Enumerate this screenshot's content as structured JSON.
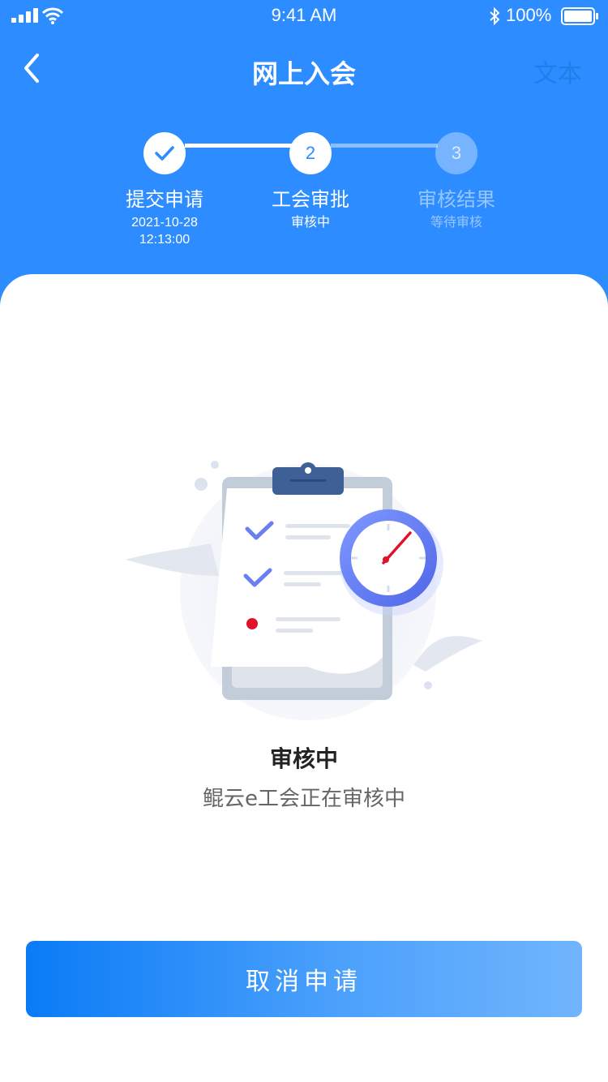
{
  "status_bar": {
    "time": "9:41 AM",
    "battery_percent": "100%",
    "icons": [
      "signal-icon",
      "wifi-icon",
      "bluetooth-icon",
      "battery-icon"
    ]
  },
  "nav": {
    "back_icon": "chevron-left-icon",
    "title": "网上入会",
    "right_text": "文本"
  },
  "steps": [
    {
      "number": "",
      "label": "提交申请",
      "sub": "2021-10-28",
      "sub2": "12:13:00",
      "state": "done",
      "icon": "check-icon"
    },
    {
      "number": "2",
      "label": "工会审批",
      "sub": "审核中",
      "state": "current"
    },
    {
      "number": "3",
      "label": "审核结果",
      "sub": "等待审核",
      "state": "pending"
    }
  ],
  "status": {
    "illustration": "clipboard-clock-illustration",
    "title": "审核中",
    "description": "鲲云e工会正在审核中"
  },
  "actions": {
    "cancel_label": "取消申请"
  },
  "colors": {
    "primary": "#2d8cff",
    "accent_red": "#e0112b",
    "text_dark": "#222222",
    "text_gray": "#666666"
  }
}
